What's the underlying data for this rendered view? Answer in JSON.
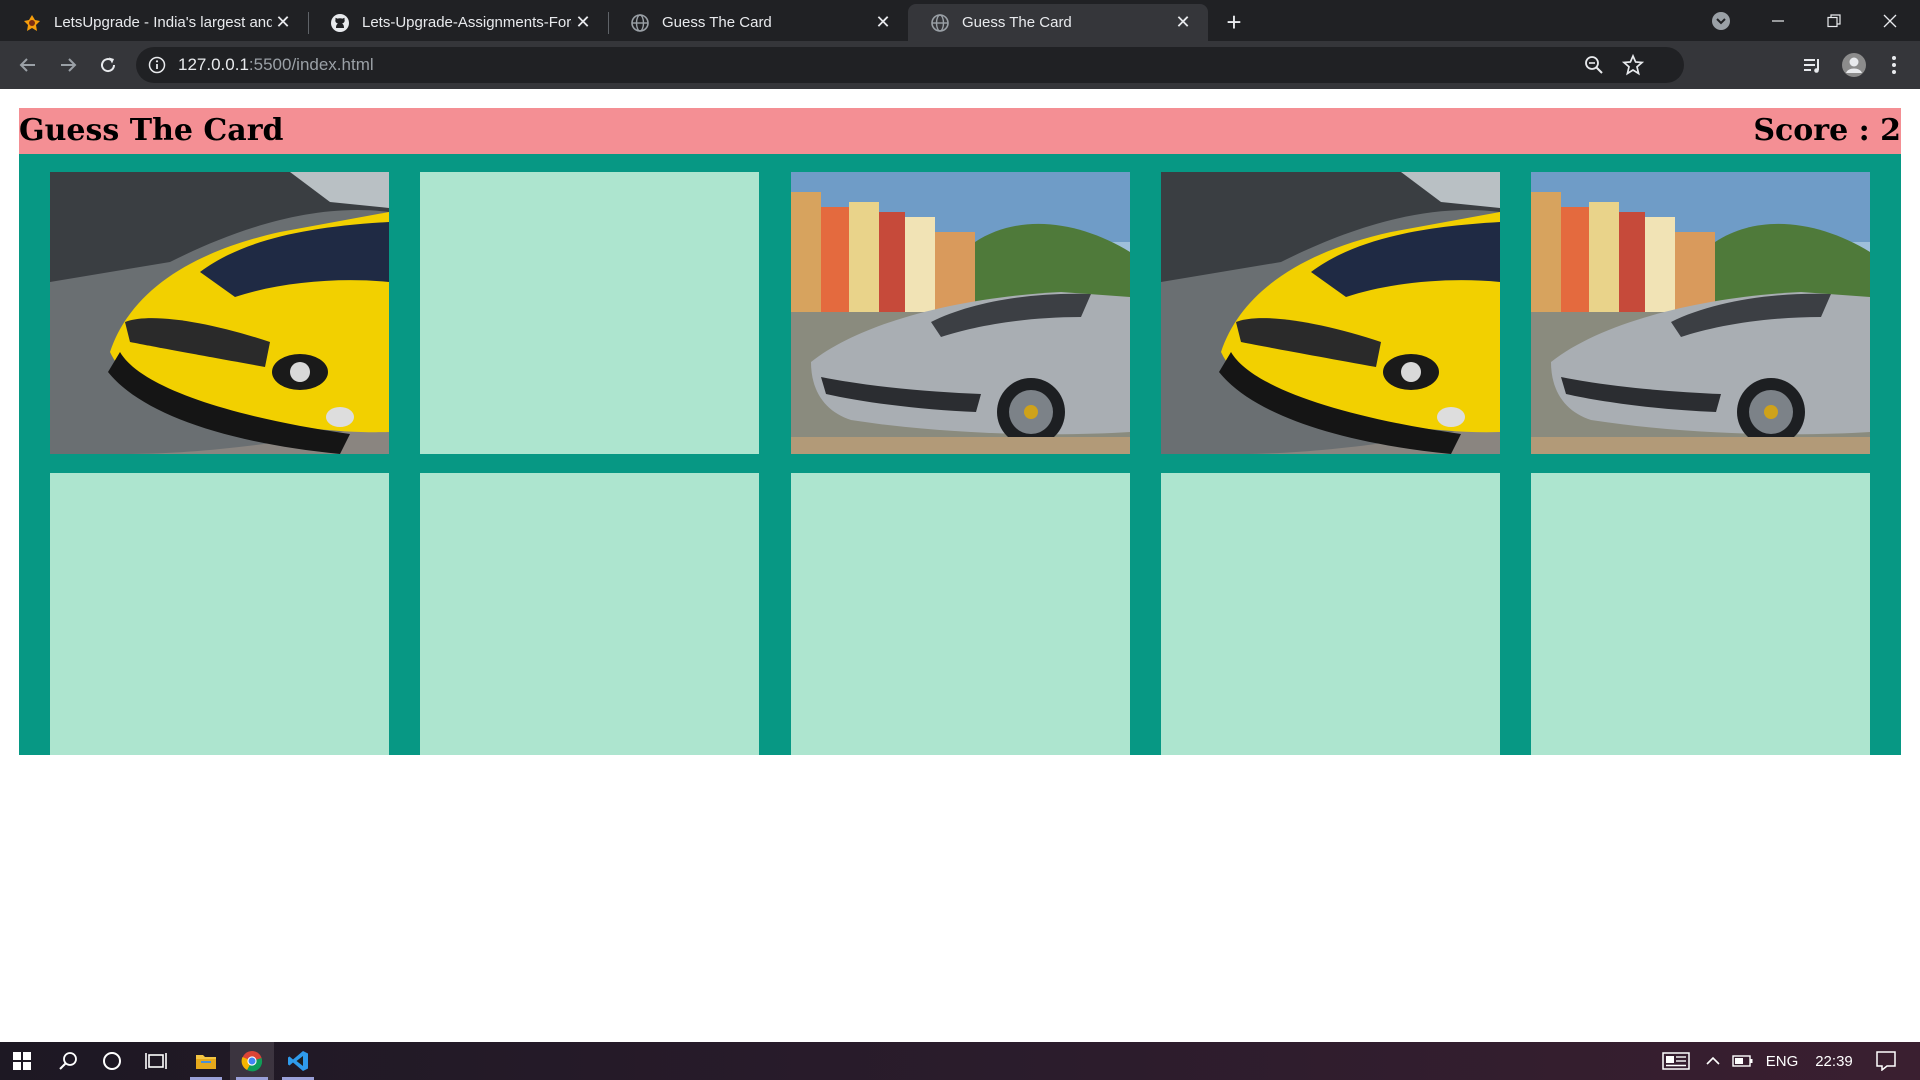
{
  "browser": {
    "tabs": [
      {
        "title": "LetsUpgrade - India's largest and",
        "icon": "letsupgrade-icon",
        "active": false
      },
      {
        "title": "Lets-Upgrade-Assignments-For-J",
        "icon": "github-icon",
        "active": false
      },
      {
        "title": "Guess The Card",
        "icon": "globe-icon",
        "active": false
      },
      {
        "title": "Guess The Card",
        "icon": "globe-icon",
        "active": true
      }
    ],
    "url_host": "127.0.0.1",
    "url_path": ":5500/index.html"
  },
  "page": {
    "title": "Guess The Card",
    "score_label": "Score : 2",
    "cards": [
      {
        "state": "revealed",
        "image": "yellow-sports-car"
      },
      {
        "state": "hidden"
      },
      {
        "state": "revealed",
        "image": "silver-convertible"
      },
      {
        "state": "revealed",
        "image": "yellow-sports-car"
      },
      {
        "state": "revealed",
        "image": "silver-convertible"
      },
      {
        "state": "hidden"
      },
      {
        "state": "hidden"
      },
      {
        "state": "hidden"
      },
      {
        "state": "hidden"
      },
      {
        "state": "hidden"
      }
    ]
  },
  "taskbar": {
    "language": "ENG",
    "time": "22:39"
  },
  "colors": {
    "header": "#f48f94",
    "board": "#079884",
    "card_back": "#ade5cf"
  }
}
